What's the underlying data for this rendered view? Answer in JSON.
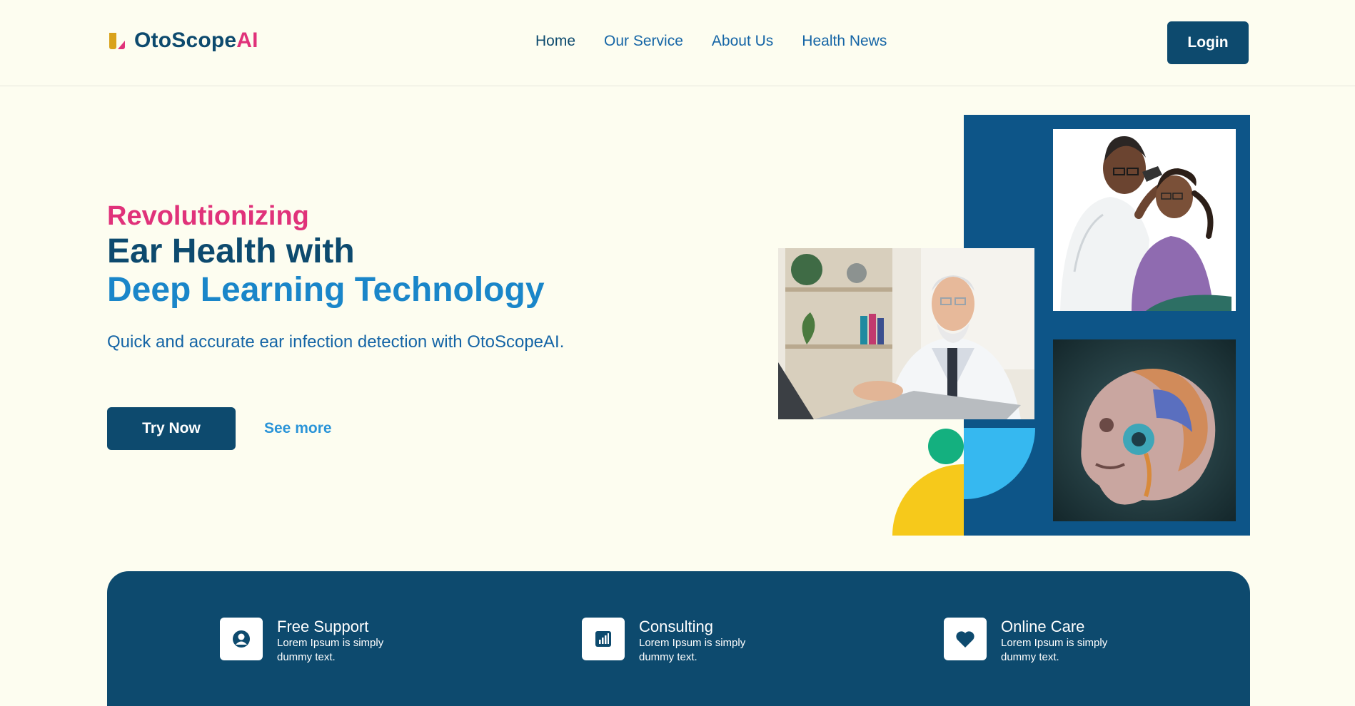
{
  "brand": {
    "name_main": "OtoScope",
    "name_accent": "AI",
    "colors": {
      "primary": "#0d4a6e",
      "accent": "#e0327a",
      "link": "#1565a6",
      "highlight": "#1a86c9",
      "background": "#fdfdf0"
    }
  },
  "nav": {
    "items": [
      {
        "label": "Home",
        "active": true
      },
      {
        "label": "Our Service",
        "active": false
      },
      {
        "label": "About Us",
        "active": false
      },
      {
        "label": "Health News",
        "active": false
      }
    ],
    "login_label": "Login"
  },
  "hero": {
    "kicker": "Revolutionizing",
    "headline_line1": "Ear Health with",
    "headline_line2": "Deep Learning Technology",
    "subtitle": "Quick and accurate ear infection detection with OtoScopeAI.",
    "primary_cta": "Try Now",
    "secondary_cta": "See more",
    "images": [
      "doctor-at-laptop-photo",
      "doctor-examining-child-ear-illustration",
      "ear-anatomy-illustration"
    ]
  },
  "features": [
    {
      "title": "Free Support",
      "description": "Lorem Ipsum is simply dummy text.",
      "icon": "user-icon"
    },
    {
      "title": "Consulting",
      "description": "Lorem Ipsum is simply dummy text.",
      "icon": "bar-chart-icon"
    },
    {
      "title": "Online Care",
      "description": "Lorem Ipsum is simply dummy text.",
      "icon": "heart-icon"
    }
  ]
}
